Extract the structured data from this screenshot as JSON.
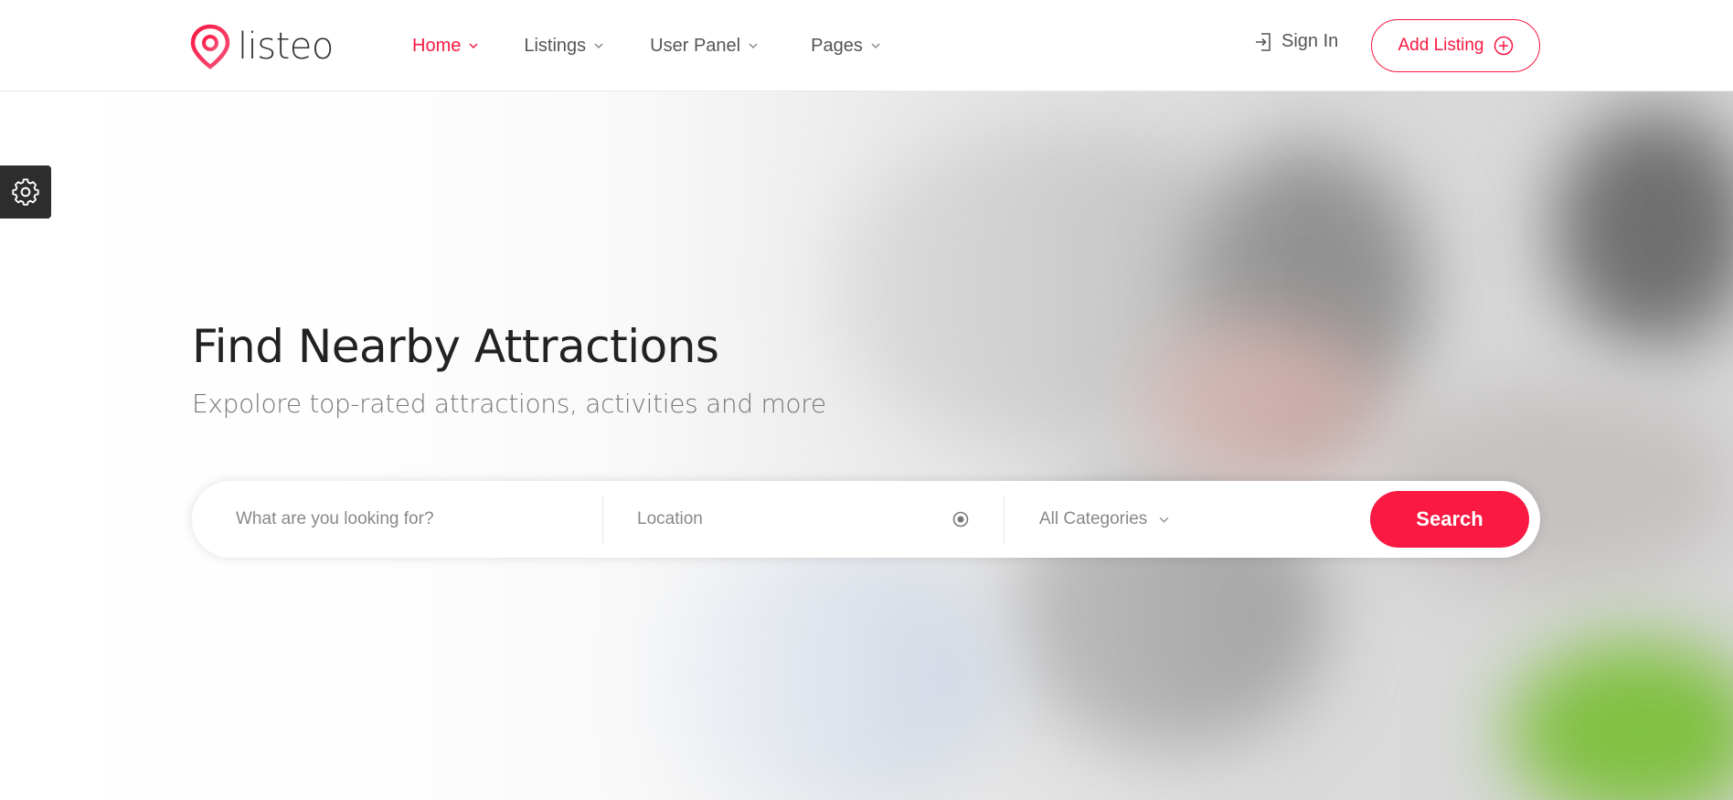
{
  "brand": {
    "name": "listeo",
    "accent": "#f91942"
  },
  "nav": {
    "items": [
      {
        "label": "Home",
        "active": true
      },
      {
        "label": "Listings",
        "active": false
      },
      {
        "label": "User Panel",
        "active": false
      },
      {
        "label": "Pages",
        "active": false
      }
    ],
    "sign_in": "Sign In",
    "add_listing": "Add Listing"
  },
  "hero": {
    "title": "Find Nearby Attractions",
    "subtitle": "Expolore top-rated attractions, activities and more"
  },
  "search": {
    "what_placeholder": "What are you looking for?",
    "location_placeholder": "Location",
    "category_selected": "All Categories",
    "button_label": "Search"
  },
  "icons": {
    "settings": "gear-icon",
    "logo": "map-pin-icon",
    "sign_in": "sign-in-icon",
    "add": "plus-circle-icon",
    "location": "target-icon"
  }
}
